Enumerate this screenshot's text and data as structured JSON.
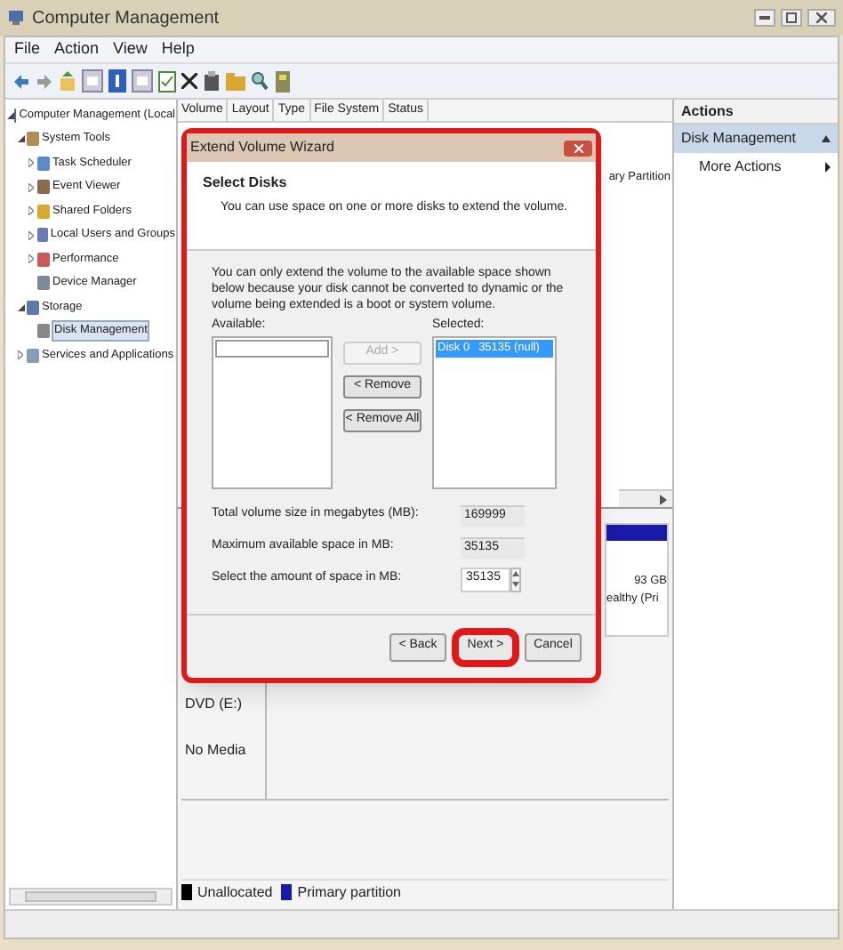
{
  "window": {
    "title": "Computer Management"
  },
  "menu": [
    "File",
    "Action",
    "View",
    "Help"
  ],
  "tree": [
    {
      "label": "Computer Management (Local",
      "expanded": true,
      "selected": false,
      "children": [
        {
          "label": "System Tools",
          "expanded": true,
          "selected": false,
          "children": [
            {
              "label": "Task Scheduler",
              "expanded": false,
              "selected": false
            },
            {
              "label": "Event Viewer",
              "expanded": false,
              "selected": false
            },
            {
              "label": "Shared Folders",
              "expanded": false,
              "selected": false
            },
            {
              "label": "Local Users and Groups",
              "expanded": false,
              "selected": false
            },
            {
              "label": "Performance",
              "expanded": false,
              "selected": false
            },
            {
              "label": "Device Manager",
              "selected": false
            }
          ]
        },
        {
          "label": "Storage",
          "expanded": true,
          "selected": false,
          "children": [
            {
              "label": "Disk Management",
              "selected": true
            }
          ]
        },
        {
          "label": "Services and Applications",
          "expanded": false,
          "selected": false
        }
      ]
    }
  ],
  "columns": [
    "Volume",
    "Layout",
    "Type",
    "File System",
    "Status"
  ],
  "volume_row_text": "ary Partition",
  "disk_partition": {
    "size": "93 GB",
    "status": "ealthy (Pri"
  },
  "cdrom": {
    "name": "DVD (E:)",
    "status": "No Media"
  },
  "legend": [
    {
      "label": "Unallocated",
      "color": "#000000"
    },
    {
      "label": "Primary partition",
      "color": "#1a1aa8"
    }
  ],
  "actions": {
    "title": "Actions",
    "items": [
      {
        "label": "Disk Management",
        "kind": "header"
      },
      {
        "label": "More Actions",
        "kind": "item"
      }
    ]
  },
  "dialog": {
    "title": "Extend Volume Wizard",
    "heading": "Select Disks",
    "subheading": "You can use space on one or more disks to extend the volume.",
    "note": "You can only extend the volume to the available space shown below because your disk cannot be converted to dynamic or the volume being extended is a boot or system volume.",
    "available_label": "Available:",
    "selected_label": "Selected:",
    "selected_disks": [
      {
        "name": "Disk 0",
        "size": "35135 (null)",
        "selected": true
      }
    ],
    "move_buttons": [
      {
        "label": "Add >",
        "disabled": true
      },
      {
        "label": "< Remove",
        "disabled": false
      },
      {
        "label": "< Remove All",
        "disabled": false
      }
    ],
    "fields": [
      {
        "label": "Total volume size in megabytes (MB):",
        "value": "169999",
        "kind": "readonly"
      },
      {
        "label": "Maximum available space in MB:",
        "value": "35135",
        "kind": "readonly"
      },
      {
        "label": "Select the amount of space in MB:",
        "value": "35135",
        "kind": "spinner"
      }
    ],
    "buttons": [
      {
        "label": "< Back",
        "highlighted": false
      },
      {
        "label": "Next >",
        "highlighted": true
      },
      {
        "label": "Cancel",
        "highlighted": false
      }
    ]
  }
}
